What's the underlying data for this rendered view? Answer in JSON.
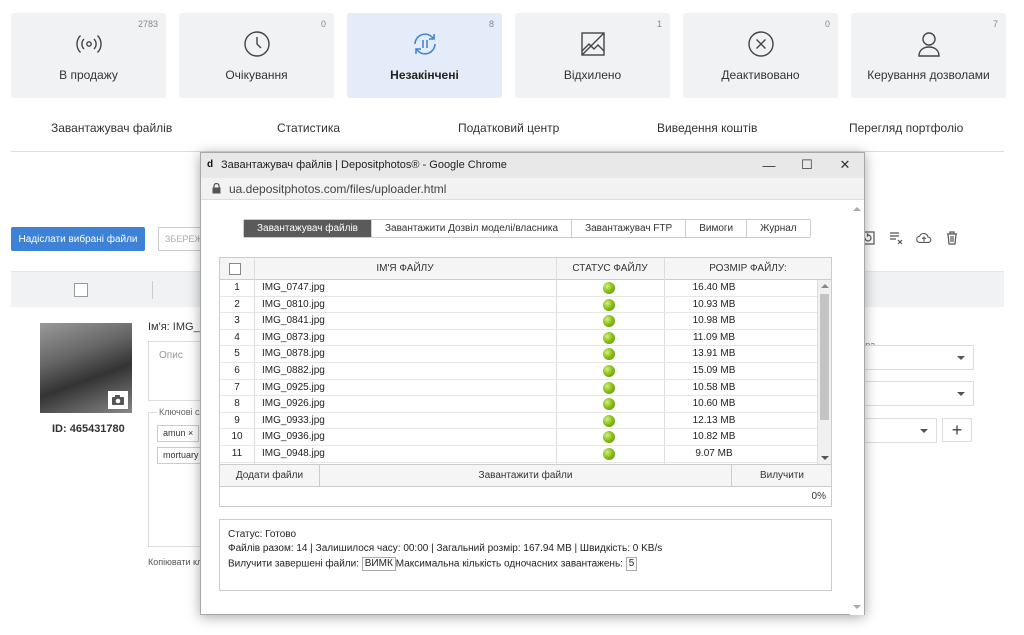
{
  "tiles": [
    {
      "label": "В продажу",
      "count": "2783",
      "icon": "broadcast-icon"
    },
    {
      "label": "Очікування",
      "count": "0",
      "icon": "clock-icon"
    },
    {
      "label": "Незакінчені",
      "count": "8",
      "icon": "sync-pause-icon"
    },
    {
      "label": "Відхилено",
      "count": "1",
      "icon": "rejected-image-icon"
    },
    {
      "label": "Деактивовано",
      "count": "0",
      "icon": "close-circle-icon"
    },
    {
      "label": "Керування дозволами",
      "count": "7",
      "icon": "user-icon"
    }
  ],
  "subnav": [
    "Завантажувач файлів",
    "Статистика",
    "Податковий центр",
    "Виведення коштів",
    "Перегляд портфоліо"
  ],
  "bg": {
    "send_button": "Надіслати вибрані файли",
    "save_button": "ЗБЕРЕЖ",
    "name_label": "Ім'я: IMG_0",
    "description_placeholder": "Опис",
    "keywords_label": "Ключові сл",
    "tags": [
      "amun ×",
      "mortuary"
    ],
    "copy_label": "Копіювати кл",
    "id_label": "ID: 465431780",
    "right_label": "гра"
  },
  "window": {
    "title": "Завантажувач файлів | Depositphotos® - Google Chrome",
    "favicon": "d",
    "url": "ua.depositphotos.com/files/uploader.html",
    "minimize": "—",
    "maximize": "☐",
    "close": "✕"
  },
  "tabs": [
    "Завантажувач файлів",
    "Завантажити Дозвіл моделі/власника",
    "Завантажувач FTP",
    "Вимоги",
    "Журнал"
  ],
  "table": {
    "headers": {
      "name": "ІМ'Я ФАЙЛУ",
      "status": "СТАТУС ФАЙЛУ",
      "size": "РОЗМІР ФАЙЛУ:"
    },
    "rows": [
      {
        "num": "1",
        "name": "IMG_0747.jpg",
        "size": "16.40 MB"
      },
      {
        "num": "2",
        "name": "IMG_0810.jpg",
        "size": "10.93 MB"
      },
      {
        "num": "3",
        "name": "IMG_0841.jpg",
        "size": "10.98 MB"
      },
      {
        "num": "4",
        "name": "IMG_0873.jpg",
        "size": "11.09 MB"
      },
      {
        "num": "5",
        "name": "IMG_0878.jpg",
        "size": "13.91 MB"
      },
      {
        "num": "6",
        "name": "IMG_0882.jpg",
        "size": "15.09 MB"
      },
      {
        "num": "7",
        "name": "IMG_0925.jpg",
        "size": "10.58 MB"
      },
      {
        "num": "8",
        "name": "IMG_0926.jpg",
        "size": "10.60 MB"
      },
      {
        "num": "9",
        "name": "IMG_0933.jpg",
        "size": "12.13 MB"
      },
      {
        "num": "10",
        "name": "IMG_0936.jpg",
        "size": "10.82 MB"
      },
      {
        "num": "11",
        "name": "IMG_0948.jpg",
        "size": "9.07 MB"
      }
    ]
  },
  "actions": {
    "add": "Додати файли",
    "upload": "Завантажити файли",
    "remove": "Вилучити"
  },
  "progress": "0%",
  "status": {
    "line1": "Статус: Готово",
    "line2": "Файлів разом: 14 | Залишилося часу: 00:00 | Загальний розмір: 167.94 MB | Швидкість: 0 KB/s",
    "line3_label": "Вилучити завершені файли:",
    "line3_value": "ВИМК",
    "line3_max_label": "Максимальна кількість одночасних завантажень:",
    "line3_max_value": "5"
  },
  "colors": {
    "accent": "#3d82d6",
    "active_tile": "#e3ecf8",
    "status_ok": "#8bc21c"
  }
}
